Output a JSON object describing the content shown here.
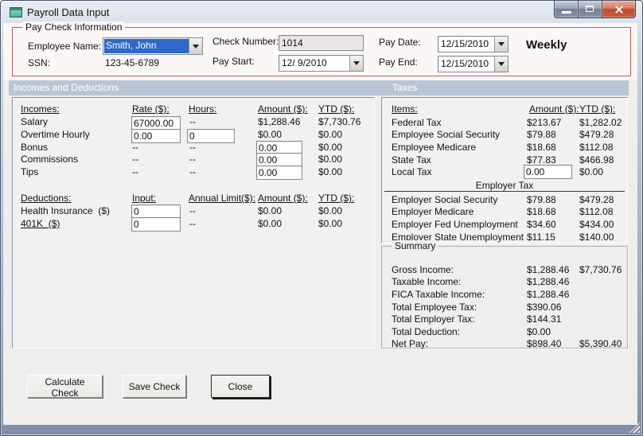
{
  "window": {
    "title": "Payroll Data Input"
  },
  "paycheck": {
    "group_label": "Pay Check Information",
    "employee_name": {
      "label": "Employee Name:",
      "value": "Smith, John"
    },
    "ssn": {
      "label": "SSN:",
      "value": "123-45-6789"
    },
    "check_number": {
      "label": "Check Number:",
      "value": "1014"
    },
    "pay_start": {
      "label": "Pay Start:",
      "value": "12/ 9/2010"
    },
    "pay_date": {
      "label": "Pay Date:",
      "value": "12/15/2010"
    },
    "pay_end": {
      "label": "Pay End:",
      "value": "12/15/2010"
    },
    "frequency": "Weekly"
  },
  "section_bar": {
    "left": "Incomes and Deductions",
    "right": "Taxes"
  },
  "incomes": {
    "headers": {
      "name": "Incomes:",
      "rate": "Rate ($):",
      "hours": "Hours:",
      "amount": "Amount ($):",
      "ytd": "YTD ($):"
    },
    "rows": [
      {
        "name": "Salary",
        "rate_input": "67000.00",
        "hours": "--",
        "amount": "$1,288.46",
        "ytd": "$7,730.76"
      },
      {
        "name": "Overtime Hourly",
        "rate_input": "0.00",
        "hours_input": "0",
        "amount": "$0.00",
        "ytd": "$0.00"
      },
      {
        "name": "Bonus",
        "rate": "--",
        "hours": "--",
        "amount_input": "0.00",
        "ytd": "$0.00"
      },
      {
        "name": "Commissions",
        "rate": "--",
        "hours": "--",
        "amount_input": "0.00",
        "ytd": "$0.00"
      },
      {
        "name": "Tips",
        "rate": "--",
        "hours": "--",
        "amount_input": "0.00",
        "ytd": "$0.00"
      }
    ]
  },
  "deductions": {
    "headers": {
      "name": "Deductions:",
      "input": "Input:",
      "annual_limit": "Annual Limit($):",
      "amount": "Amount ($):",
      "ytd": "YTD ($):"
    },
    "rows": [
      {
        "name": "Health Insurance  ($)",
        "input": "0",
        "annual_limit": "--",
        "amount": "$0.00",
        "ytd": "$0.00"
      },
      {
        "name": "401K  ($)",
        "input": "0",
        "annual_limit": "--",
        "amount": "$0.00",
        "ytd": "$0.00"
      }
    ]
  },
  "taxes": {
    "headers": {
      "items": "Items:",
      "amount": "Amount ($):",
      "ytd": "YTD ($):"
    },
    "employee_rows": [
      {
        "name": "Federal Tax",
        "amount": "$213.67",
        "ytd": "$1,282.02"
      },
      {
        "name": "Employee Social Security",
        "amount": "$79.88",
        "ytd": "$479.28"
      },
      {
        "name": "Employee Medicare",
        "amount": "$18.68",
        "ytd": "$112.08"
      },
      {
        "name": "State Tax",
        "amount": "$77.83",
        "ytd": "$466.98"
      },
      {
        "name": "Local Tax",
        "amount_input": "0.00",
        "ytd": "$0.00"
      }
    ],
    "employer_header": "Employer Tax",
    "employer_rows": [
      {
        "name": "Employer Social Security",
        "amount": "$79.88",
        "ytd": "$479.28"
      },
      {
        "name": "Employer Medicare",
        "amount": "$18.68",
        "ytd": "$112.08"
      },
      {
        "name": "Employer Fed Unemployment",
        "amount": "$34.60",
        "ytd": "$434.00"
      },
      {
        "name": "Employer State Unemployment",
        "amount": "$11.15",
        "ytd": "$140.00"
      }
    ]
  },
  "summary": {
    "group_label": "Summary",
    "rows": [
      {
        "label": "Gross Income:",
        "amount": "$1,288.46",
        "ytd": "$7,730.76"
      },
      {
        "label": "Taxable Income:",
        "amount": "$1,288.46",
        "ytd": ""
      },
      {
        "label": "FICA Taxable Income:",
        "amount": "$1,288.46",
        "ytd": ""
      },
      {
        "label": "Total Employee Tax:",
        "amount": "$390.06",
        "ytd": ""
      },
      {
        "label": "Total Employer Tax:",
        "amount": "$144.31",
        "ytd": ""
      },
      {
        "label": "Total Deduction:",
        "amount": "$0.00",
        "ytd": ""
      },
      {
        "label": "Net Pay:",
        "amount": "$898.40",
        "ytd": "$5,390.40"
      }
    ]
  },
  "buttons": {
    "calculate": "Calculate Check",
    "save": "Save Check",
    "close": "Close"
  },
  "colors": {
    "group_border": "#B7605C",
    "section_bar_bg": "#B9C5D2",
    "selection_blue": "#2D68CB",
    "close_button_red": "#C2503A"
  }
}
